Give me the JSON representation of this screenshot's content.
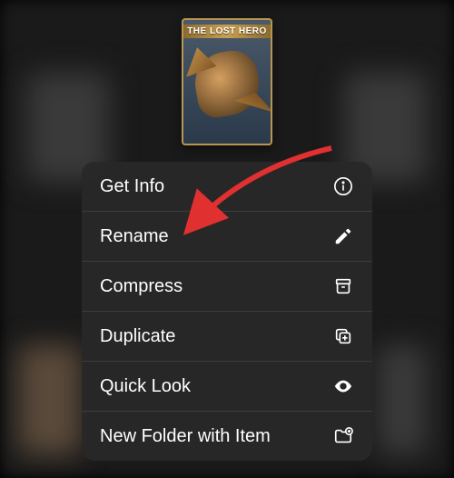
{
  "thumbnail": {
    "title": "THE LOST HERO"
  },
  "menu": {
    "items": [
      {
        "label": "Get Info",
        "icon": "info-icon"
      },
      {
        "label": "Rename",
        "icon": "pencil-icon"
      },
      {
        "label": "Compress",
        "icon": "archive-icon"
      },
      {
        "label": "Duplicate",
        "icon": "duplicate-icon"
      },
      {
        "label": "Quick Look",
        "icon": "eye-icon"
      },
      {
        "label": "New Folder with Item",
        "icon": "folder-plus-icon"
      }
    ]
  },
  "annotation": {
    "arrow_target": "Rename",
    "arrow_color": "#e03030"
  }
}
